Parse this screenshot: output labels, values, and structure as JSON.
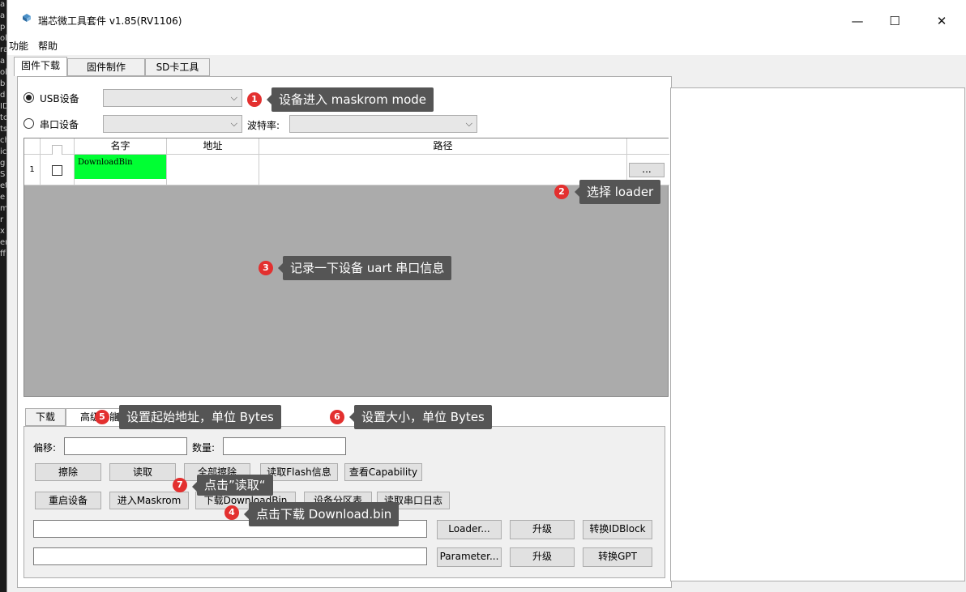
{
  "window": {
    "title": "瑞芯微工具套件 v1.85(RV1106)",
    "minimize_glyph": "—",
    "maximize_glyph": "☐",
    "close_glyph": "✕"
  },
  "menu": [
    "功能",
    "帮助"
  ],
  "tabs": [
    "固件下载",
    "固件制作",
    "SD卡工具"
  ],
  "device": {
    "usb_label": "USB设备",
    "serial_label": "串口设备",
    "baud_label": "波特率:"
  },
  "grid": {
    "headers": [
      "名字",
      "地址",
      "路径"
    ],
    "rows": [
      {
        "num": "1",
        "name": "DownloadBin",
        "address": "",
        "path": "",
        "browse": "..."
      }
    ]
  },
  "bottom_tabs": [
    "下载",
    "高级功能"
  ],
  "advanced": {
    "offset_label": "偏移:",
    "count_label": "数量:",
    "buttons_row1": [
      "擦除",
      "读取",
      "全部擦除",
      "读取Flash信息",
      "查看Capability"
    ],
    "buttons_row2": [
      "重启设备",
      "进入Maskrom",
      "下载DownloadBin",
      "设备分区表",
      "读取串口日志"
    ],
    "loader_button": "Loader...",
    "upgrade_button": "升级",
    "idblock_button": "转换IDBlock",
    "parameter_button": "Parameter...",
    "upgrade_button2": "升级",
    "gpt_button": "转换GPT"
  },
  "callouts": [
    {
      "num": "1",
      "text": "设备进入 maskrom mode"
    },
    {
      "num": "2",
      "text": "选择 loader"
    },
    {
      "num": "3",
      "text": "记录一下设备 uart 串口信息"
    },
    {
      "num": "4",
      "text": "点击下载 Download.bin"
    },
    {
      "num": "5",
      "text": "设置起始地址，单位 Bytes"
    },
    {
      "num": "6",
      "text": "设置大小，单位 Bytes"
    },
    {
      "num": "7",
      "text": "点击”读取“"
    }
  ],
  "colors": {
    "callout_bg": "#555555",
    "badge": "#e3302f",
    "downloadbin_cell": "#00ff33"
  }
}
